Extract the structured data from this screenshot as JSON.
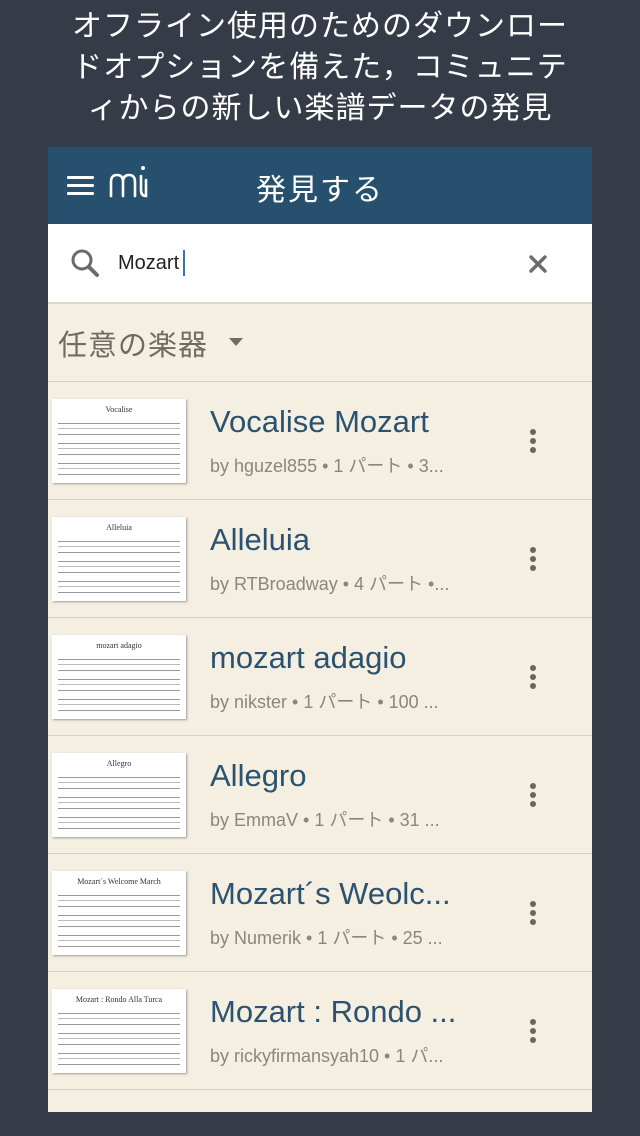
{
  "promo": {
    "line1": "オフライン使用のためのダウンロー",
    "line2": "ドオプションを備えた，コミュニテ",
    "line3": "ィからの新しい楽譜データの発見"
  },
  "appbar": {
    "title": "発見する",
    "menu_icon": "hamburger-menu-icon",
    "logo_icon": "musescore-logo"
  },
  "search": {
    "value": "Mozart",
    "search_icon": "search-icon",
    "clear_icon": "close-icon",
    "clear_glyph": "✕"
  },
  "filter": {
    "label": "任意の楽器",
    "icon": "dropdown-caret-icon"
  },
  "results": [
    {
      "title": "Vocalise Mozart",
      "subtitle": "by hguzel855 • 1 パート • 3...",
      "thumb_title": "Vocalise"
    },
    {
      "title": "Alleluia",
      "subtitle": "by RTBroadway • 4 パート •...",
      "thumb_title": "Alleluia"
    },
    {
      "title": "mozart adagio",
      "subtitle": "by nikster • 1 パート • 100 ...",
      "thumb_title": "mozart adagio"
    },
    {
      "title": "Allegro",
      "subtitle": "by EmmaV • 1 パート • 31 ...",
      "thumb_title": "Allegro"
    },
    {
      "title": "Mozart´s Weolc...",
      "subtitle": "by Numerik • 1 パート • 25 ...",
      "thumb_title": "Mozart´s Welcome March"
    },
    {
      "title": "Mozart : Rondo ...",
      "subtitle": "by rickyfirmansyah10 • 1 パ...",
      "thumb_title": "Mozart : Rondo Alla Turca"
    }
  ],
  "colors": {
    "appbar": "#27506e",
    "background": "#f5efe2",
    "title_text": "#2b5270",
    "outer": "#363c47"
  }
}
